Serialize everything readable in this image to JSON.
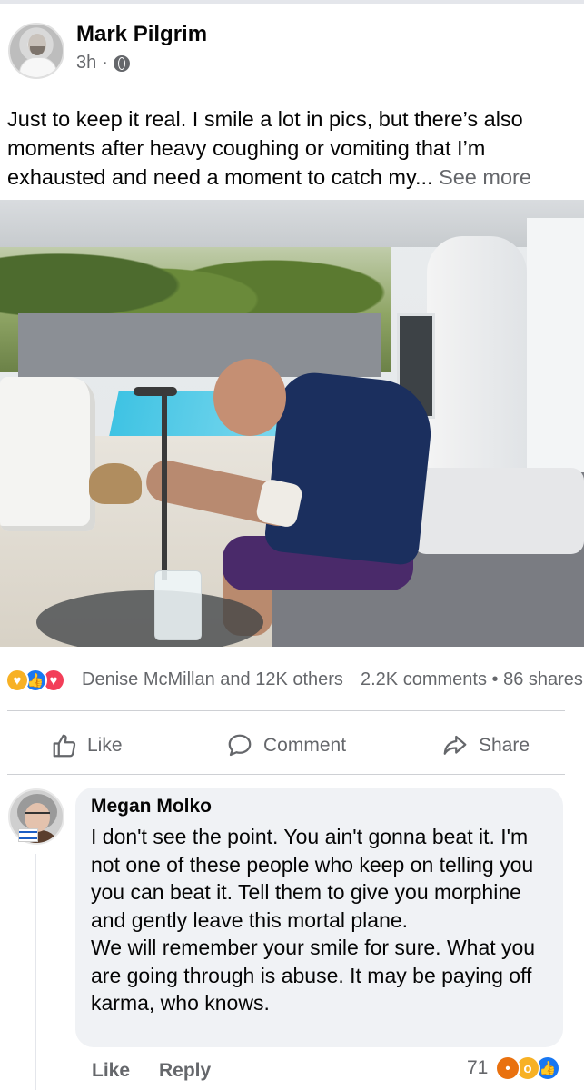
{
  "post": {
    "author": "Mark Pilgrim",
    "time": "3h",
    "separator": "·",
    "privacy_icon": "globe-icon",
    "text": "Just to keep it real. I smile a lot in pics, but there’s also moments after heavy coughing or vomiting that I’m exhausted and need a moment to catch my...",
    "see_more": "See more"
  },
  "reactions": {
    "icons": [
      "care-reaction-icon",
      "like-reaction-icon",
      "love-reaction-icon"
    ],
    "summary": "Denise McMillan and 12K others",
    "comments": "2.2K comments",
    "dot": "•",
    "shares": "86 shares"
  },
  "actions": {
    "like": "Like",
    "comment": "Comment",
    "share": "Share"
  },
  "comment": {
    "author": "Megan Molko",
    "text": "I don't see the point. You ain't gonna beat it. I'm not one of these people who keep on telling you you can beat it. Tell them to give you morphine and gently leave this mortal plane.\nWe will remember your smile for sure. What you are going through is abuse. It may be paying off karma, who knows.",
    "like": "Like",
    "reply": "Reply",
    "reaction_count": "71",
    "reaction_icons": [
      "angry-reaction-icon",
      "wow-reaction-icon",
      "like-reaction-icon"
    ]
  },
  "colors": {
    "accent_blue": "#1877f2",
    "secondary_text": "#65676b",
    "bubble_bg": "#f0f2f5"
  }
}
